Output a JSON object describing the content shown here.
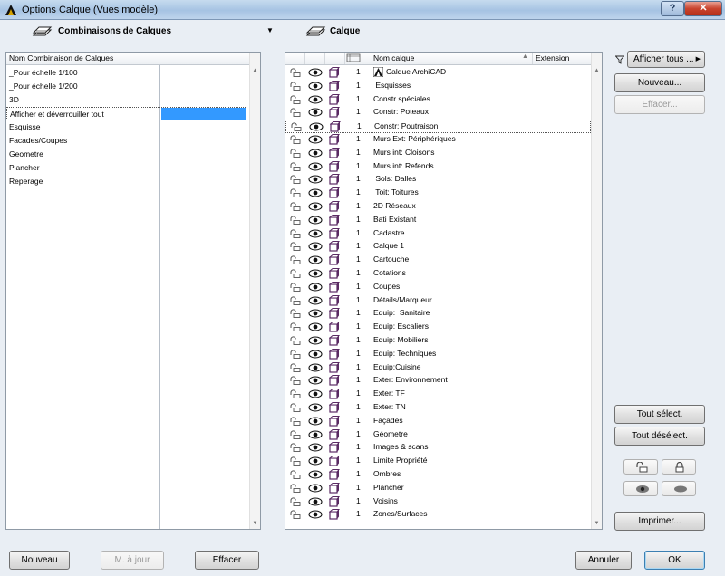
{
  "window": {
    "title": "Options Calque (Vues modèle)",
    "help_label": "?",
    "close_label": "✕"
  },
  "combinations": {
    "header": "Combinaisons de Calques",
    "column_header": "Nom Combinaison de Calques",
    "items": [
      {
        "label": "_Pour échelle 1/100"
      },
      {
        "label": "_Pour échelle 1/200"
      },
      {
        "label": "3D"
      },
      {
        "label": "Afficher et déverrouiller tout"
      },
      {
        "label": "Esquisse"
      },
      {
        "label": "Facades/Coupes"
      },
      {
        "label": "Geometre"
      },
      {
        "label": "Plancher"
      },
      {
        "label": "Reperage"
      }
    ],
    "selected_index": 3,
    "buttons": {
      "new": "Nouveau",
      "update": "M. à jour",
      "delete": "Effacer"
    }
  },
  "layers": {
    "header": "Calque",
    "column_name": "Nom calque",
    "column_extension": "Extension",
    "selected_index": 4,
    "rows": [
      {
        "num": "1",
        "name": "Calque ArchiCAD",
        "archicad": true
      },
      {
        "num": "1",
        "name": " Esquisses"
      },
      {
        "num": "1",
        "name": "Constr spéciales"
      },
      {
        "num": "1",
        "name": "Constr: Poteaux"
      },
      {
        "num": "1",
        "name": "Constr: Poutraison"
      },
      {
        "num": "1",
        "name": "Murs Ext: Périphériques"
      },
      {
        "num": "1",
        "name": "Murs int: Cloisons"
      },
      {
        "num": "1",
        "name": "Murs int: Refends"
      },
      {
        "num": "1",
        "name": " Sols: Dalles"
      },
      {
        "num": "1",
        "name": " Toit: Toitures"
      },
      {
        "num": "1",
        "name": "2D Réseaux"
      },
      {
        "num": "1",
        "name": "Bati Existant"
      },
      {
        "num": "1",
        "name": "Cadastre"
      },
      {
        "num": "1",
        "name": "Calque 1"
      },
      {
        "num": "1",
        "name": "Cartouche"
      },
      {
        "num": "1",
        "name": "Cotations"
      },
      {
        "num": "1",
        "name": "Coupes"
      },
      {
        "num": "1",
        "name": "Détails/Marqueur"
      },
      {
        "num": "1",
        "name": "Equip:  Sanitaire"
      },
      {
        "num": "1",
        "name": "Equip: Escaliers"
      },
      {
        "num": "1",
        "name": "Equip: Mobiliers"
      },
      {
        "num": "1",
        "name": "Equip: Techniques"
      },
      {
        "num": "1",
        "name": "Equip:Cuisine"
      },
      {
        "num": "1",
        "name": "Exter: Environnement"
      },
      {
        "num": "1",
        "name": "Exter: TF"
      },
      {
        "num": "1",
        "name": "Exter: TN"
      },
      {
        "num": "1",
        "name": "Façades"
      },
      {
        "num": "1",
        "name": "Géometre"
      },
      {
        "num": "1",
        "name": "Images & scans"
      },
      {
        "num": "1",
        "name": "Limite Propriété"
      },
      {
        "num": "1",
        "name": "Ombres"
      },
      {
        "num": "1",
        "name": "Plancher"
      },
      {
        "num": "1",
        "name": "Voisins"
      },
      {
        "num": "1",
        "name": "Zones/Surfaces"
      }
    ]
  },
  "actions": {
    "show_all": "Afficher tous ...",
    "new": "Nouveau...",
    "delete": "Effacer...",
    "select_all": "Tout sélect.",
    "deselect_all": "Tout désélect.",
    "print": "Imprimer...",
    "cancel": "Annuler",
    "ok": "OK"
  },
  "colors": {
    "selection": "#3399ff",
    "eye": "#000000",
    "wireframe": "#5a2a63"
  }
}
